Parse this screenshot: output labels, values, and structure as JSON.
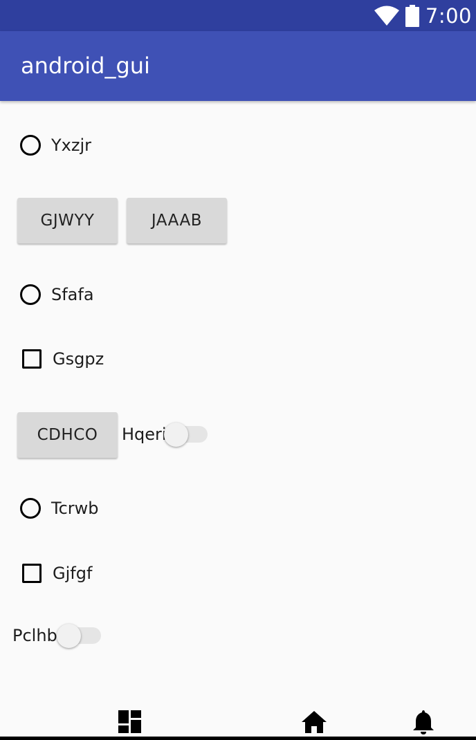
{
  "status_bar": {
    "time": "7:00",
    "icons": [
      "wifi-icon",
      "battery-icon"
    ]
  },
  "app_bar": {
    "title": "android_gui"
  },
  "widgets": {
    "radio_1": {
      "label": "Yxzjr",
      "checked": false
    },
    "button_1": {
      "label": "GJWYY"
    },
    "button_2": {
      "label": "JAAAB"
    },
    "radio_2": {
      "label": "Sfafa",
      "checked": false
    },
    "checkbox_1": {
      "label": "Gsgpz",
      "checked": false
    },
    "button_3": {
      "label": "CDHCO"
    },
    "switch_1": {
      "label": "Hqeri",
      "on": false
    },
    "radio_3": {
      "label": "Tcrwb",
      "checked": false
    },
    "checkbox_2": {
      "label": "Gjfgf",
      "checked": false
    },
    "switch_2": {
      "label": "Pclhb",
      "on": false
    }
  },
  "bottom_nav": {
    "icons": [
      "dashboard-icon",
      "home-icon",
      "notifications-icon"
    ]
  },
  "colors": {
    "primary": "#3f51b5",
    "primary_dark": "#2f3f9e",
    "background": "#fafafa",
    "button": "#d9d9d9"
  }
}
